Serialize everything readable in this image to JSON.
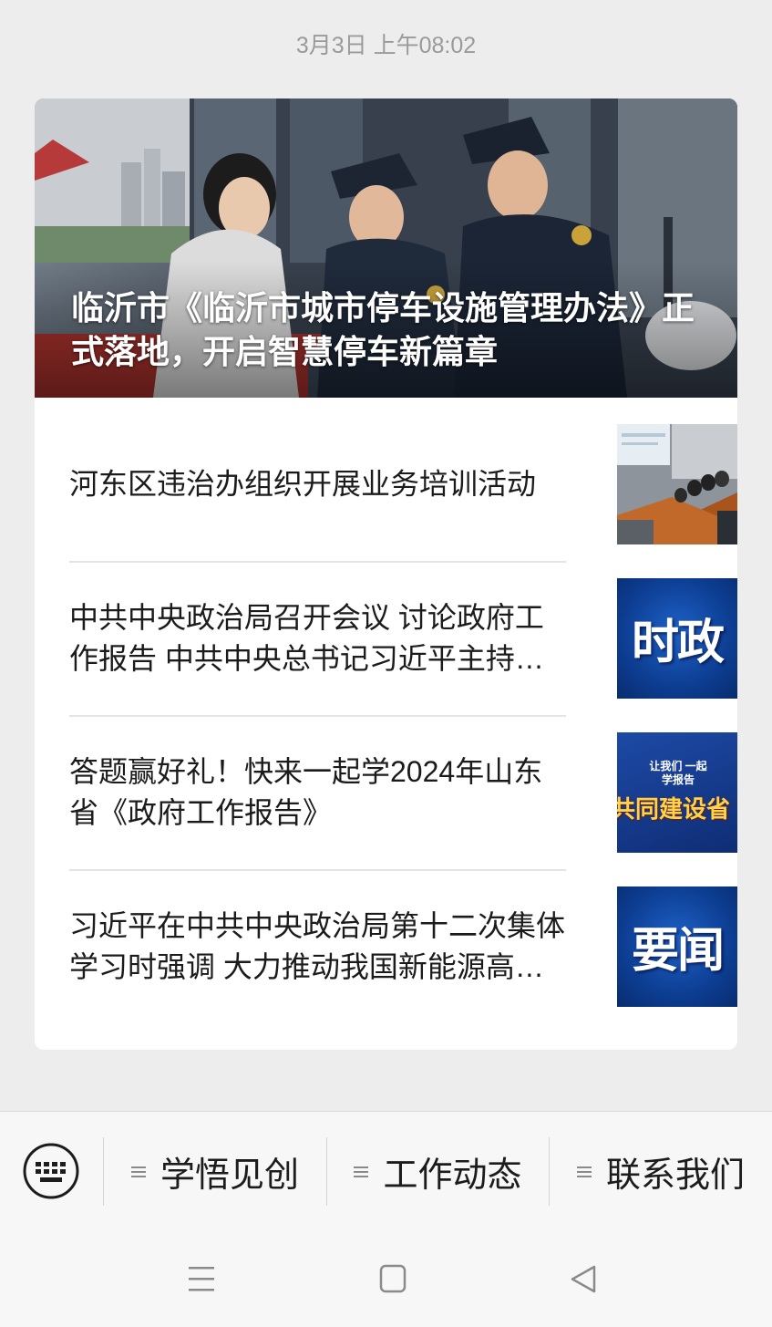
{
  "timestamp": "3月3日 上午08:02",
  "hero": {
    "title": "临沂市《临沂市城市停车设施管理办法》正式落地，开启智慧停车新篇章"
  },
  "articles": [
    {
      "title": "河东区违治办组织开展业务培训活动",
      "thumb": {
        "type": "photo"
      }
    },
    {
      "title": "中共中央政治局召开会议 讨论政府工作报告 中共中央总书记习近平主持会议",
      "thumb": {
        "type": "text",
        "text": "时政"
      }
    },
    {
      "title": "答题赢好礼！快来一起学2024年山东省《政府工作报告》",
      "thumb": {
        "type": "quiz",
        "small_text": "让我们 一起学报告",
        "big_text": "共同建设省"
      }
    },
    {
      "title": "习近平在中共中央政治局第十二次集体学习时强调 大力推动我国新能源高质量发展",
      "thumb": {
        "type": "text",
        "text": "要闻"
      }
    }
  ],
  "menu": {
    "keyboard_icon": "keyboard-icon",
    "items": [
      {
        "label": "学悟见创",
        "icon": "menu-lines-icon"
      },
      {
        "label": "工作动态",
        "icon": "menu-lines-icon"
      },
      {
        "label": "联系我们",
        "icon": "menu-lines-icon"
      }
    ]
  },
  "system_nav": {
    "menu_icon": "hamburger-icon",
    "home_icon": "square-home-icon",
    "back_icon": "triangle-back-icon"
  },
  "colors": {
    "background": "#ededed",
    "card": "#ffffff",
    "thumb_blue": "#0d3e93",
    "quiz_gold": "#ffd24a"
  }
}
